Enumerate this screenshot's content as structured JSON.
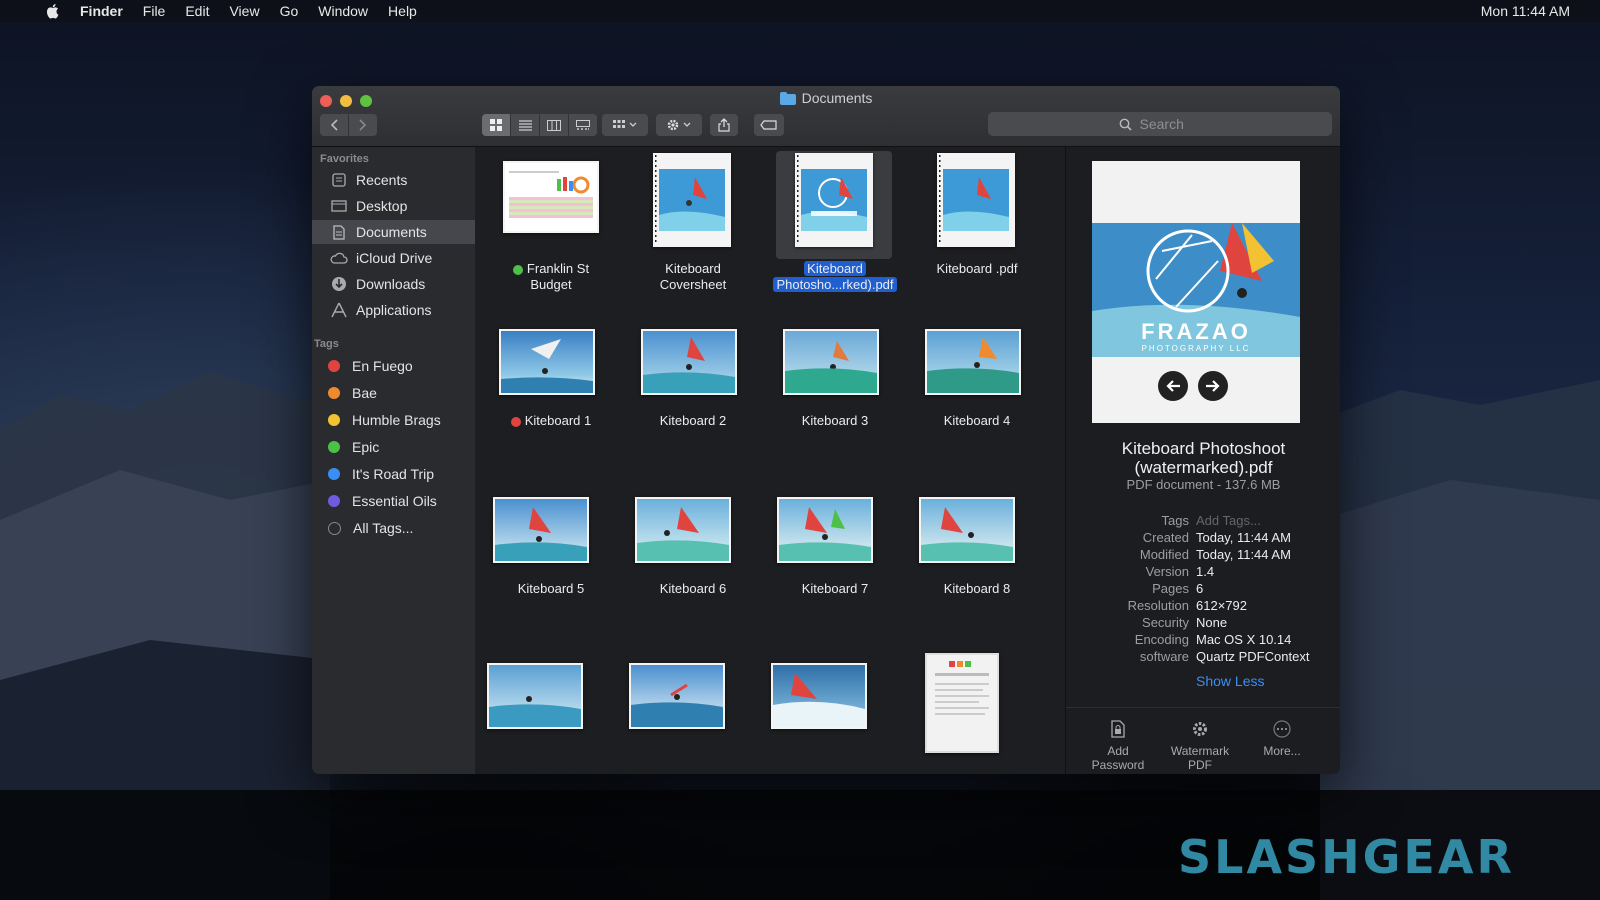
{
  "menubar": {
    "app": "Finder",
    "items": [
      "File",
      "Edit",
      "View",
      "Go",
      "Window",
      "Help"
    ],
    "clock": "Mon 11:44 AM"
  },
  "window": {
    "title": "Documents",
    "search_placeholder": "Search",
    "view_mode": "icon"
  },
  "sidebar": {
    "favorites_header": "Favorites",
    "favorites": [
      {
        "label": "Recents",
        "icon": "recents-icon"
      },
      {
        "label": "Desktop",
        "icon": "desktop-icon"
      },
      {
        "label": "Documents",
        "icon": "documents-icon",
        "selected": true
      },
      {
        "label": "iCloud Drive",
        "icon": "cloud-icon"
      },
      {
        "label": "Downloads",
        "icon": "download-icon"
      },
      {
        "label": "Applications",
        "icon": "applications-icon"
      }
    ],
    "tags_header": "Tags",
    "tags": [
      {
        "label": "En Fuego",
        "color": "#e0443e"
      },
      {
        "label": "Bae",
        "color": "#f08a2e"
      },
      {
        "label": "Humble Brags",
        "color": "#f2c233"
      },
      {
        "label": "Epic",
        "color": "#4cc047"
      },
      {
        "label": "It's Road Trip",
        "color": "#3a8ef5"
      },
      {
        "label": "Essential Oils",
        "color": "#6e5ce0"
      },
      {
        "label": "All Tags...",
        "color": "#888888"
      }
    ]
  },
  "files": [
    {
      "name": "Franklin St Budget",
      "line1": "Franklin St",
      "line2": "Budget",
      "tag": "#4cc047"
    },
    {
      "name": "Kiteboard Coversheet",
      "line1": "Kiteboard",
      "line2": "Coversheet"
    },
    {
      "name": "Kiteboard Photosho...rked).pdf",
      "line1": "Kiteboard",
      "line2": "Photosho...rked).pdf",
      "selected": true
    },
    {
      "name": "Kiteboard .pdf",
      "line1": "Kiteboard .pdf",
      "line2": ""
    },
    {
      "name": "Kiteboard 1",
      "line1": "Kiteboard 1",
      "line2": "",
      "tag": "#e0443e"
    },
    {
      "name": "Kiteboard 2",
      "line1": "Kiteboard 2",
      "line2": ""
    },
    {
      "name": "Kiteboard 3",
      "line1": "Kiteboard 3",
      "line2": ""
    },
    {
      "name": "Kiteboard 4",
      "line1": "Kiteboard 4",
      "line2": ""
    },
    {
      "name": "Kiteboard 5",
      "line1": "Kiteboard 5",
      "line2": ""
    },
    {
      "name": "Kiteboard 6",
      "line1": "Kiteboard 6",
      "line2": ""
    },
    {
      "name": "Kiteboard 7",
      "line1": "Kiteboard 7",
      "line2": ""
    },
    {
      "name": "Kiteboard 8",
      "line1": "Kiteboard 8",
      "line2": ""
    }
  ],
  "preview": {
    "title_line1": "Kiteboard Photoshoot",
    "title_line2": "(watermarked).pdf",
    "subtitle": "PDF document - 137.6 MB",
    "brand_text": "FRAZAO",
    "brand_sub": "PHOTOGRAPHY LLC",
    "metadata": [
      {
        "key": "Tags",
        "value": "Add Tags...",
        "placeholder": true
      },
      {
        "key": "Created",
        "value": "Today, 11:44 AM"
      },
      {
        "key": "Modified",
        "value": "Today, 11:44 AM"
      },
      {
        "key": "Version",
        "value": "1.4"
      },
      {
        "key": "Pages",
        "value": "6"
      },
      {
        "key": "Resolution",
        "value": "612×792"
      },
      {
        "key": "Security",
        "value": "None"
      },
      {
        "key": "Encoding",
        "value": "Mac OS X 10.14"
      },
      {
        "key": "software",
        "value": "Quartz PDFContext"
      }
    ],
    "show_less": "Show Less",
    "actions": [
      {
        "line1": "Add",
        "line2": "Password",
        "icon": "document-lock-icon"
      },
      {
        "line1": "Watermark",
        "line2": "PDF",
        "icon": "gear-icon"
      },
      {
        "line1": "More...",
        "line2": "",
        "icon": "more-icon"
      }
    ]
  },
  "watermark": "SLASHGEAR"
}
